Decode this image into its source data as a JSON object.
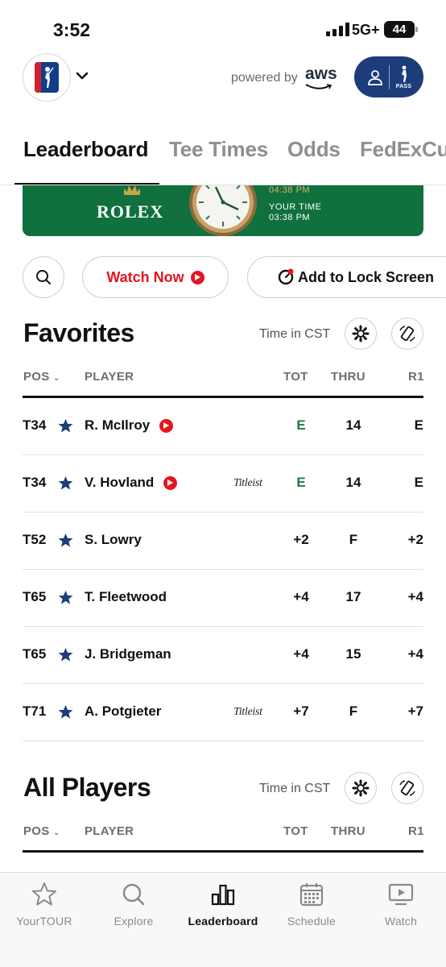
{
  "status": {
    "time": "3:52",
    "network": "5G+",
    "battery": "44"
  },
  "header": {
    "powered_by": "powered by",
    "aws": "aws",
    "pass_label": "PASS"
  },
  "tabs": [
    {
      "label": "Leaderboard",
      "active": true
    },
    {
      "label": "Tee Times",
      "active": false
    },
    {
      "label": "Odds",
      "active": false
    },
    {
      "label": "FedExCup",
      "active": false
    }
  ],
  "banner": {
    "brand": "ROLEX",
    "local_time": "04:38 PM",
    "your_time_label": "YOUR TIME",
    "your_time": "03:38 PM",
    "color": "#10703e"
  },
  "actions": {
    "watch_now": "Watch Now",
    "add_to_lock_screen": "Add to Lock Screen"
  },
  "favorites": {
    "title": "Favorites",
    "time_label": "Time in CST",
    "columns": {
      "pos": "POS",
      "player": "PLAYER",
      "tot": "TOT",
      "thru": "THRU",
      "r1": "R1"
    },
    "rows": [
      {
        "pos": "T34",
        "player": "R. McIlroy",
        "live": true,
        "sponsor": "",
        "tot": "E",
        "thru": "14",
        "r1": "E"
      },
      {
        "pos": "T34",
        "player": "V. Hovland",
        "live": true,
        "sponsor": "Titleist",
        "tot": "E",
        "thru": "14",
        "r1": "E"
      },
      {
        "pos": "T52",
        "player": "S. Lowry",
        "live": false,
        "sponsor": "",
        "tot": "+2",
        "thru": "F",
        "r1": "+2"
      },
      {
        "pos": "T65",
        "player": "T. Fleetwood",
        "live": false,
        "sponsor": "",
        "tot": "+4",
        "thru": "17",
        "r1": "+4"
      },
      {
        "pos": "T65",
        "player": "J. Bridgeman",
        "live": false,
        "sponsor": "",
        "tot": "+4",
        "thru": "15",
        "r1": "+4"
      },
      {
        "pos": "T71",
        "player": "A. Potgieter",
        "live": false,
        "sponsor": "Titleist",
        "tot": "+7",
        "thru": "F",
        "r1": "+7"
      }
    ]
  },
  "all_players": {
    "title": "All Players",
    "time_label": "Time in CST",
    "columns": {
      "pos": "POS",
      "player": "PLAYER",
      "tot": "TOT",
      "thru": "THRU",
      "r1": "R1"
    }
  },
  "nav": [
    {
      "label": "YourTOUR",
      "icon": "star-icon",
      "active": false
    },
    {
      "label": "Explore",
      "icon": "search-icon",
      "active": false
    },
    {
      "label": "Leaderboard",
      "icon": "bar-chart-icon",
      "active": true
    },
    {
      "label": "Schedule",
      "icon": "calendar-icon",
      "active": false
    },
    {
      "label": "Watch",
      "icon": "play-screen-icon",
      "active": false
    }
  ],
  "colors": {
    "accent_red": "#e5141e",
    "navy": "#1d3c7a",
    "star_navy": "#1f3c7b",
    "even_green": "#1f7a46"
  }
}
